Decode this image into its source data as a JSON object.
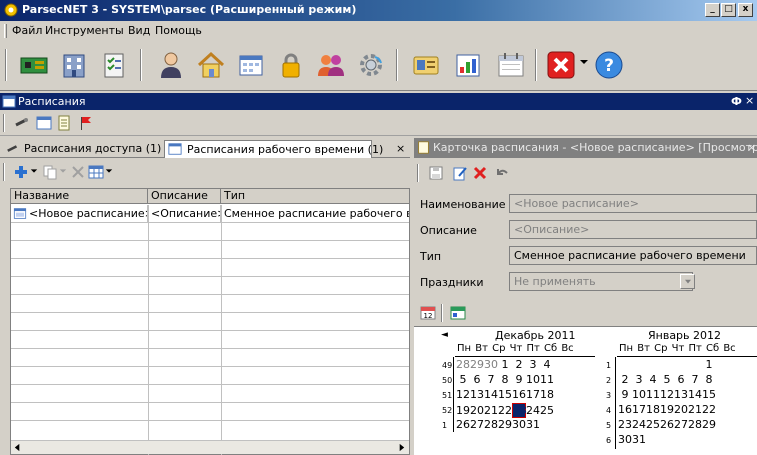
{
  "window": {
    "title": "ParsecNET 3 - SYSTEM\\parsec (Расширенный режим)",
    "minimize": "_",
    "maximize": "□",
    "close": "x"
  },
  "menu": [
    "Файл",
    "Инструменты",
    "Вид",
    "Помощь"
  ],
  "panel": {
    "title": "Расписания",
    "pin": "Ф",
    "close": "×"
  },
  "tabs": [
    {
      "label": "Расписания доступа (1)"
    },
    {
      "label": "Расписания рабочего времени (1)"
    }
  ],
  "tab_close": "×",
  "grid": {
    "columns": [
      "Название",
      "Описание",
      "Тип"
    ],
    "rows": [
      {
        "name": "<Новое расписание>",
        "description": "<Описание>",
        "type": "Сменное расписание рабочего вре"
      }
    ]
  },
  "card": {
    "title": "Карточка расписания - <Новое расписание> [Просмотр]",
    "close": "×",
    "fields": [
      {
        "label": "Наименование",
        "value": "<Новое расписание>"
      },
      {
        "label": "Описание",
        "value": "<Описание>"
      },
      {
        "label": "Тип",
        "value": "Сменное расписание рабочего времени"
      },
      {
        "label": "Праздники",
        "value": "Не применять"
      }
    ]
  },
  "calendar": {
    "nav_prev": "◄",
    "months": [
      {
        "title": "Декабрь 2011",
        "dow": "Пн Вт Ср Чт Пт Сб Вс",
        "weeks": [
          {
            "wk": "49",
            "days": [
              "28",
              "29",
              "30",
              "1",
              "2",
              "3",
              "4"
            ]
          },
          {
            "wk": "50",
            "days": [
              "5",
              "6",
              "7",
              "8",
              "9",
              "10",
              "11"
            ]
          },
          {
            "wk": "51",
            "days": [
              "12",
              "13",
              "14",
              "15",
              "16",
              "17",
              "18"
            ]
          },
          {
            "wk": "52",
            "days": [
              "19",
              "20",
              "21",
              "22",
              "23",
              "24",
              "25"
            ]
          },
          {
            "wk": "1",
            "days": [
              "26",
              "27",
              "28",
              "29",
              "30",
              "31",
              ""
            ]
          }
        ]
      },
      {
        "title": "Январь 2012",
        "dow": "Пн Вт Ср Чт Пт Сб Вс",
        "weeks": [
          {
            "wk": "1",
            "days": [
              "",
              "",
              "",
              "",
              "",
              "",
              "1"
            ]
          },
          {
            "wk": "2",
            "days": [
              "2",
              "3",
              "4",
              "5",
              "6",
              "7",
              "8"
            ]
          },
          {
            "wk": "3",
            "days": [
              "9",
              "10",
              "11",
              "12",
              "13",
              "14",
              "15"
            ]
          },
          {
            "wk": "4",
            "days": [
              "16",
              "17",
              "18",
              "19",
              "20",
              "21",
              "22"
            ]
          },
          {
            "wk": "5",
            "days": [
              "23",
              "24",
              "25",
              "26",
              "27",
              "28",
              "29"
            ]
          },
          {
            "wk": "6",
            "days": [
              "30",
              "31",
              "",
              "",
              "",
              "",
              ""
            ]
          }
        ]
      }
    ],
    "selected_day": "23",
    "accent": "#0a246a"
  },
  "colors": {
    "title_bar": "#0a246a",
    "panel_bg": "#d4d0c8",
    "close_red": "#cc0000"
  }
}
